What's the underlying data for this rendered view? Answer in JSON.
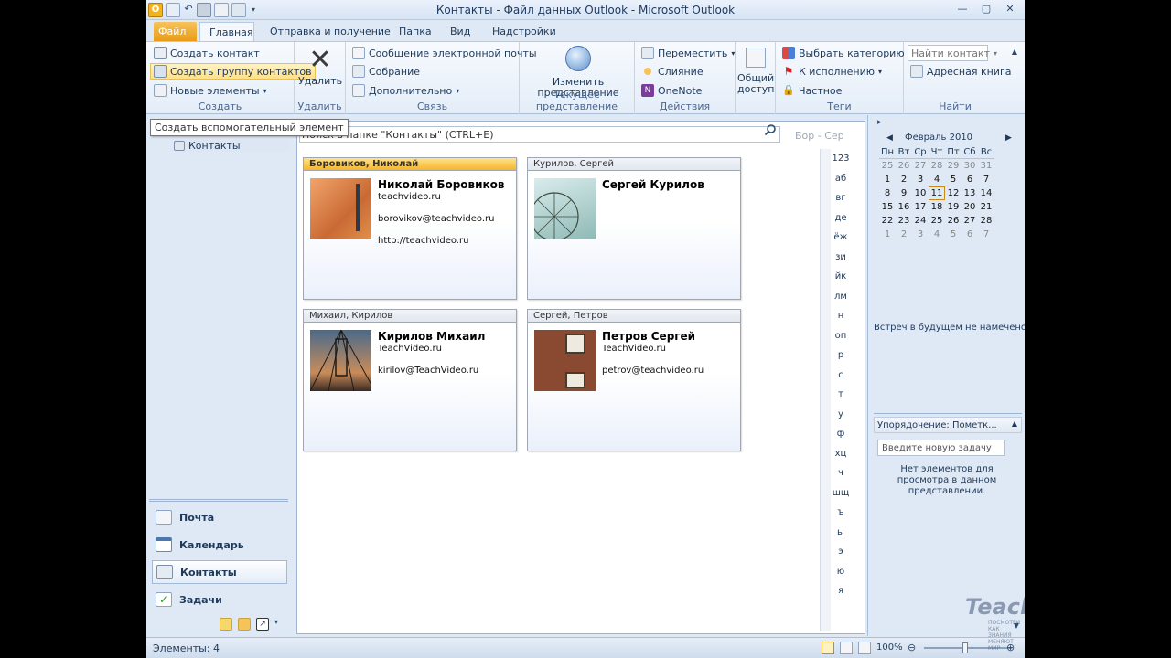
{
  "window": {
    "title": "Контакты - Файл данных Outlook - Microsoft Outlook"
  },
  "tabs": [
    "Файл",
    "Главная",
    "Отправка и получение",
    "Папка",
    "Вид",
    "Надстройки"
  ],
  "ribbon": {
    "create": {
      "label": "Создать",
      "new_contact": "Создать контакт",
      "new_group": "Создать группу контактов",
      "new_items": "Новые элементы"
    },
    "delete": {
      "label": "Удалить",
      "button": "Удалить"
    },
    "communicate": {
      "label": "Связь",
      "email": "Сообщение электронной почты",
      "meeting": "Собрание",
      "more": "Дополнительно"
    },
    "view": {
      "label": "Текущее представление",
      "change_view": "Изменить представление"
    },
    "actions": {
      "label": "Действия",
      "move": "Переместить",
      "merge": "Слияние",
      "onenote": "OneNote"
    },
    "share": {
      "button": "Общий доступ"
    },
    "tags": {
      "label": "Теги",
      "categorize": "Выбрать категорию",
      "followup": "К исполнению",
      "private": "Частное"
    },
    "find": {
      "label": "Найти",
      "find_contact": "Найти контакт",
      "address_book": "Адресная книга"
    }
  },
  "tooltip": "Создать вспомогательный элемент",
  "nav": {
    "folder": "Контакты",
    "buttons": [
      "Почта",
      "Календарь",
      "Контакты",
      "Задачи"
    ]
  },
  "search": {
    "placeholder": "Поиск в папке \"Контакты\" (CTRL+Е)",
    "range": "Бор - Сер"
  },
  "contacts": [
    {
      "file_as": "Боровиков, Николай",
      "name": "Николай Боровиков",
      "company": "teachvideo.ru",
      "email": "borovikov@teachvideo.ru",
      "web": "http://teachvideo.ru"
    },
    {
      "file_as": "Курилов, Сергей",
      "name": "Сергей Курилов",
      "company": "",
      "email": "",
      "web": ""
    },
    {
      "file_as": "Михаил, Кирилов",
      "name": "Кирилов Михаил",
      "company": "TeachVideo.ru",
      "email": "kirilov@TeachVideo.ru",
      "web": ""
    },
    {
      "file_as": "Сергей, Петров",
      "name": "Петров Сергей",
      "company": "TeachVideo.ru",
      "email": "petrov@teachvideo.ru",
      "web": ""
    }
  ],
  "alphabet": [
    "123",
    "аб",
    "вг",
    "де",
    "ёж",
    "зи",
    "йк",
    "лм",
    "н",
    "оп",
    "р",
    "с",
    "т",
    "у",
    "ф",
    "хц",
    "ч",
    "шщ",
    "ъ",
    "ы",
    "э",
    "ю",
    "я"
  ],
  "calendar": {
    "title": "Февраль 2010",
    "weekdays": [
      "Пн",
      "Вт",
      "Ср",
      "Чт",
      "Пт",
      "Сб",
      "Вс"
    ],
    "weeks": [
      [
        "25",
        "26",
        "27",
        "28",
        "29",
        "30",
        "31"
      ],
      [
        "1",
        "2",
        "3",
        "4",
        "5",
        "6",
        "7"
      ],
      [
        "8",
        "9",
        "10",
        "11",
        "12",
        "13",
        "14"
      ],
      [
        "15",
        "16",
        "17",
        "18",
        "19",
        "20",
        "21"
      ],
      [
        "22",
        "23",
        "24",
        "25",
        "26",
        "27",
        "28"
      ],
      [
        "1",
        "2",
        "3",
        "4",
        "5",
        "6",
        "7"
      ]
    ],
    "today": "11"
  },
  "todo": {
    "no_appointments": "Встреч в будущем не намечено.",
    "arrange": "Упорядочение: Пометк...",
    "new_task_placeholder": "Введите новую задачу",
    "empty": "Нет элементов для просмотра в данном представлении."
  },
  "status": {
    "items": "Элементы: 4",
    "zoom": "100%"
  },
  "watermark": {
    "brand": "TeachVideo",
    "tagline": "ПОСМОТРИ КАК ЗНАНИЯ МЕНЯЮТ МИР"
  }
}
